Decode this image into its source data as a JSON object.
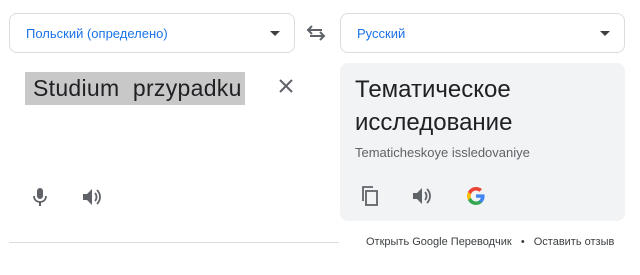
{
  "source": {
    "language_label": "Польский (определено)",
    "text": "Studium  przypadku"
  },
  "target": {
    "language_label": "Русский",
    "text": "Тематическое исследование",
    "transliteration": "Tematicheskoye issledovaniye"
  },
  "footer": {
    "open_link": "Открыть Google Переводчик",
    "separator": "•",
    "feedback_link": "Оставить отзыв"
  },
  "icons": {
    "swap": "swap-arrows-icon",
    "clear": "close-icon",
    "mic": "microphone-icon",
    "speaker": "speaker-icon",
    "copy": "copy-icon",
    "google": "google-logo-icon"
  },
  "colors": {
    "accent": "#1a73e8",
    "panel_bg": "#f1f3f4",
    "selection_bg": "#c8c8c8"
  }
}
